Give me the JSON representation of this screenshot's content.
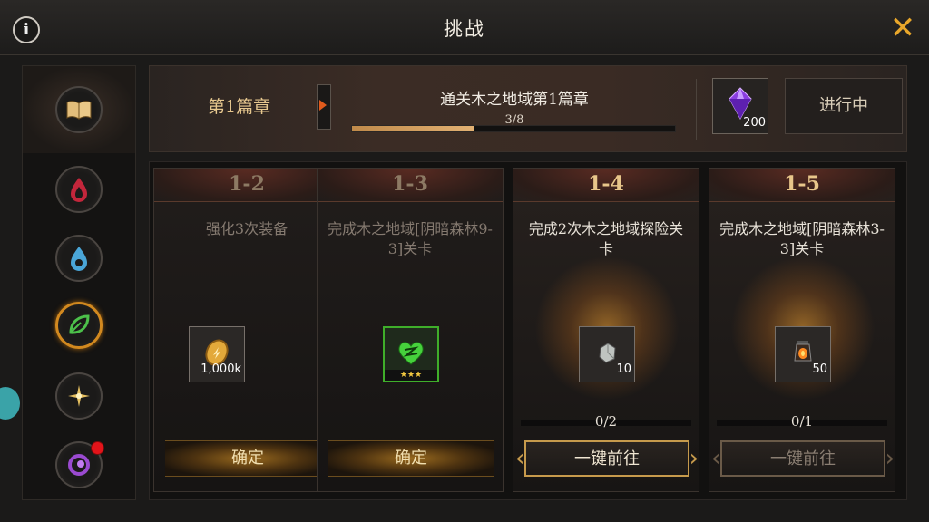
{
  "header": {
    "title": "挑战",
    "info_icon": "info-icon",
    "close_icon": "close-icon"
  },
  "sidebar": {
    "items": [
      {
        "icon": "book-icon"
      },
      {
        "icon": "fire-element-icon"
      },
      {
        "icon": "water-element-icon"
      },
      {
        "icon": "wood-element-icon",
        "active": true
      },
      {
        "icon": "light-element-icon"
      },
      {
        "icon": "dark-element-icon",
        "badge": "red-dot"
      }
    ]
  },
  "chapter": {
    "label": "第1篇章",
    "quest_title": "通关木之地域第1篇章",
    "progress_text": "3/8",
    "progress": 0.375,
    "reward_count": "200",
    "reward_icon": "purple-gem-icon",
    "status": "进行中"
  },
  "cards": [
    {
      "num": "1-2",
      "desc": "强化3次装备",
      "reward_count": "1,000k",
      "reward_icon": "gold-coin-icon",
      "button": "确定",
      "done": true
    },
    {
      "num": "1-3",
      "desc": "完成木之地域[阴暗森林9-3]关卡",
      "reward_stars": "★★★",
      "reward_icon": "green-heart-rune-icon",
      "button": "确定",
      "done": true
    },
    {
      "num": "1-4",
      "desc": "完成2次木之地域探险关卡",
      "reward_count": "10",
      "reward_icon": "silver-ore-icon",
      "progress_text": "0/2",
      "button": "一键前往",
      "done": false
    },
    {
      "num": "1-5",
      "desc": "完成木之地域[阴暗森林3-3]关卡",
      "reward_count": "50",
      "reward_icon": "lantern-icon",
      "progress_text": "0/1",
      "button": "一键前往",
      "done": false,
      "dim": true
    }
  ],
  "colors": {
    "accent": "#e9a72a",
    "active_ring": "#d2891f",
    "badge": "#e3141a"
  }
}
